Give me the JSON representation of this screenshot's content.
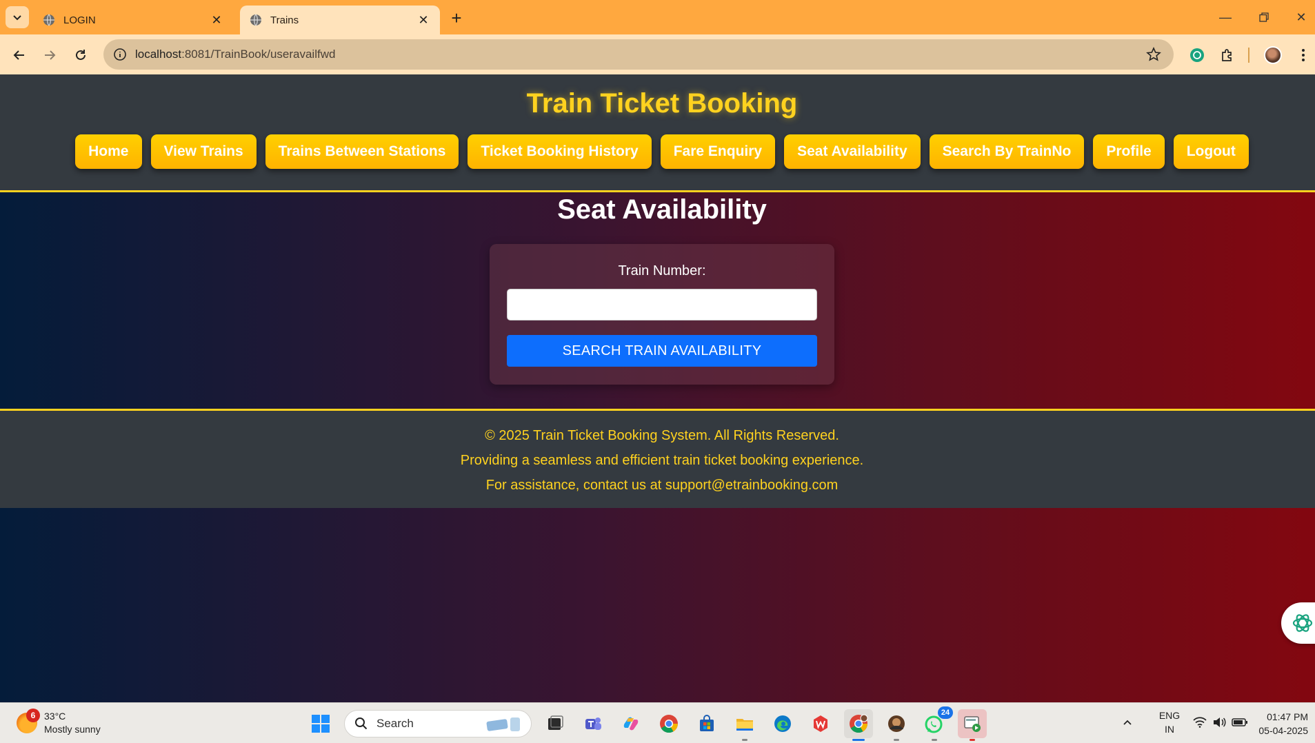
{
  "browser": {
    "tabs": [
      {
        "title": "LOGIN",
        "active": false
      },
      {
        "title": "Trains",
        "active": true
      }
    ],
    "url_host": "localhost",
    "url_rest": ":8081/TrainBook/useravailfwd"
  },
  "site": {
    "title": "Train Ticket Booking",
    "nav": [
      "Home",
      "View Trains",
      "Trains Between Stations",
      "Ticket Booking History",
      "Fare Enquiry",
      "Seat Availability",
      "Search By TrainNo",
      "Profile",
      "Logout"
    ]
  },
  "form": {
    "heading": "Seat Availability",
    "train_number_label": "Train Number:",
    "train_number_value": "",
    "submit_label": "SEARCH TRAIN AVAILABILITY"
  },
  "footer": {
    "line1": "© 2025 Train Ticket Booking System. All Rights Reserved.",
    "line2": "Providing a seamless and efficient train ticket booking experience.",
    "line3": "For assistance, contact us at support@etrainbooking.com"
  },
  "taskbar": {
    "weather_badge": "6",
    "weather_temp": "33°C",
    "weather_desc": "Mostly sunny",
    "search_label": "Search",
    "whatsapp_badge": "24",
    "lang_line1": "ENG",
    "lang_line2": "IN",
    "time": "01:47 PM",
    "date": "05-04-2025"
  },
  "colors": {
    "accent_yellow": "#ffd21f",
    "header_bg": "#343a40",
    "primary_button": "#0d6efd",
    "tab_strip": "#ffa83f"
  }
}
